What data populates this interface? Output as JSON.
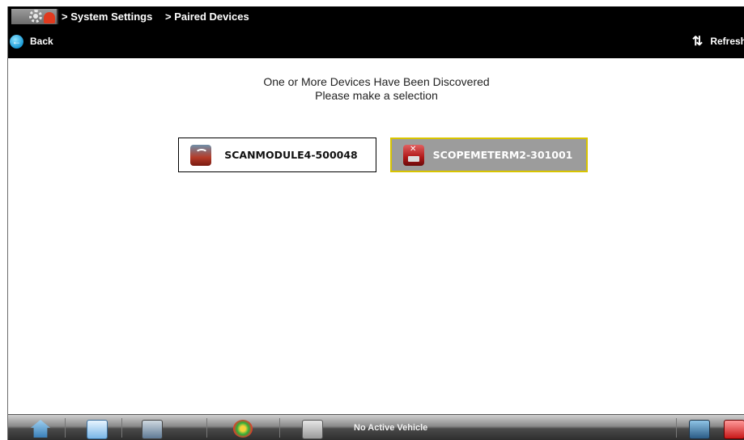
{
  "header": {
    "app_icon": "gear-flame-icon",
    "breadcrumbs": [
      "> System Settings",
      "> Paired Devices"
    ],
    "back_label": "Back",
    "back_icon": "back-arrow-icon",
    "refresh_label": "Refresh",
    "refresh_icon": "refresh-arrows-icon"
  },
  "main": {
    "message_line1": "One or More Devices Have Been Discovered",
    "message_line2": "Please make a selection",
    "devices": [
      {
        "label": "SCANMODULE4-500048",
        "icon": "scan-module-icon",
        "selected": false
      },
      {
        "label": "SCOPEMETERM2-301001",
        "icon": "scope-meter-icon",
        "selected": true
      }
    ]
  },
  "toolbar": {
    "status_text": "No Active Vehicle",
    "icons": [
      "home-icon",
      "list-icon",
      "data-manager-icon",
      "tools-icon",
      "vehicle-icon",
      "scan-module-status-icon",
      "scope-meter-status-icon"
    ]
  },
  "colors": {
    "header_bg": "#000000",
    "selected_bg": "#9c9c9c",
    "selected_border": "#d8c400"
  }
}
